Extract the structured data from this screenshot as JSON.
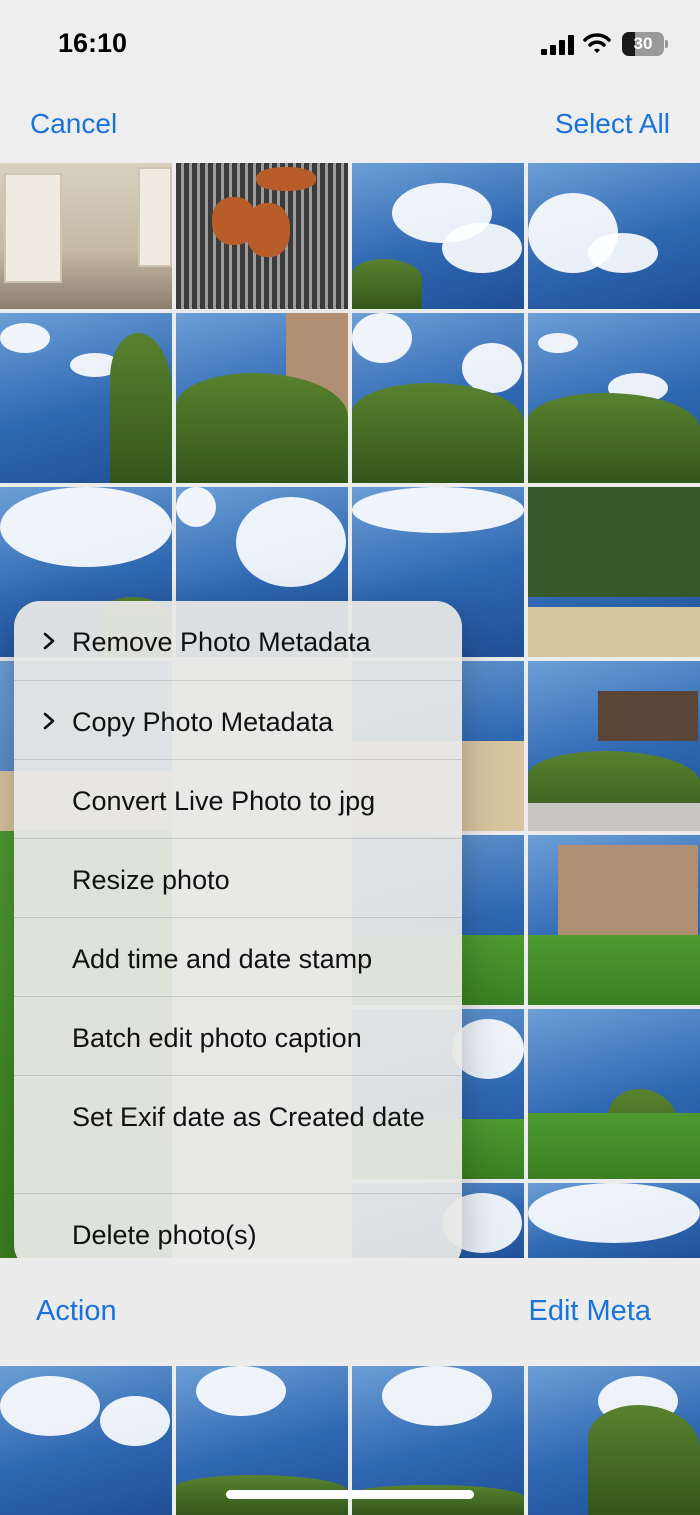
{
  "status_bar": {
    "time": "16:10",
    "battery_level": "30",
    "battery_fraction": 0.3,
    "icons": [
      "signal-icon",
      "wifi-icon",
      "battery-icon"
    ]
  },
  "nav": {
    "cancel_label": "Cancel",
    "select_all_label": "Select All"
  },
  "menu": {
    "items": [
      {
        "label": "Remove Photo Metadata",
        "has_submenu": true
      },
      {
        "label": "Copy Photo Metadata",
        "has_submenu": true
      },
      {
        "label": "Convert Live Photo to jpg",
        "has_submenu": false
      },
      {
        "label": "Resize photo",
        "has_submenu": false
      },
      {
        "label": "Add time and date stamp",
        "has_submenu": false
      },
      {
        "label": "Batch edit photo caption",
        "has_submenu": false
      },
      {
        "label": "Set Exif date as Created date",
        "has_submenu": false
      },
      {
        "label": "Delete photo(s)",
        "has_submenu": false
      }
    ]
  },
  "toolbar": {
    "action_label": "Action",
    "edit_meta_label": "Edit Meta"
  },
  "colors": {
    "accent": "#1a73d9",
    "bar_background": "#eeeeee",
    "menu_background": "#e8e8e5"
  }
}
